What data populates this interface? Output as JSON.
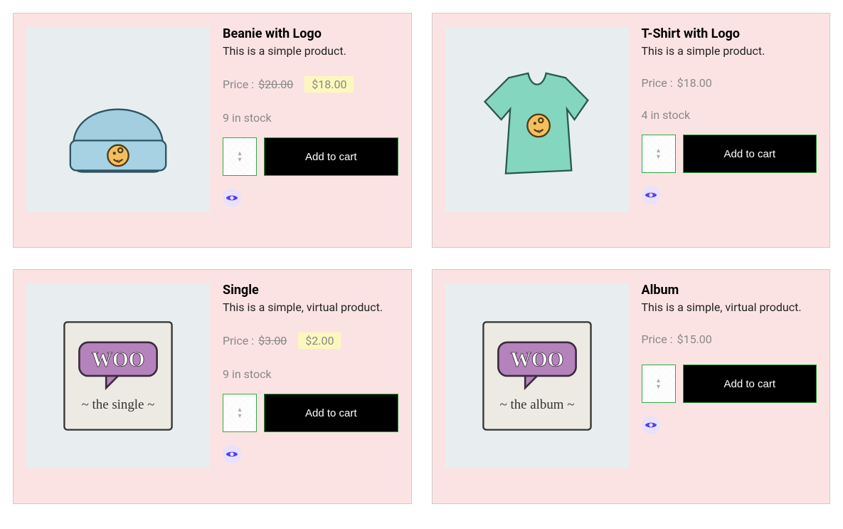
{
  "labels": {
    "price_prefix": "Price : ",
    "add_to_cart": "Add to cart"
  },
  "products": [
    {
      "image_kind": "beanie",
      "title": "Beanie with Logo",
      "description": "This is a simple product.",
      "has_sale": true,
      "old_price": "$20.00",
      "sale_price": "$18.00",
      "has_stock": true,
      "stock": "9 in stock"
    },
    {
      "image_kind": "tshirt",
      "title": "T-Shirt with Logo",
      "description": "This is a simple product.",
      "has_sale": false,
      "regular_price": "$18.00",
      "has_stock": true,
      "stock": "4 in stock"
    },
    {
      "image_kind": "woo_single",
      "title": "Single",
      "description": "This is a simple, virtual product.",
      "has_sale": true,
      "old_price": "$3.00",
      "sale_price": "$2.00",
      "has_stock": true,
      "stock": "9 in stock"
    },
    {
      "image_kind": "woo_album",
      "title": "Album",
      "description": "This is a simple, virtual product.",
      "has_sale": false,
      "regular_price": "$15.00",
      "has_stock": false,
      "stock": ""
    }
  ]
}
